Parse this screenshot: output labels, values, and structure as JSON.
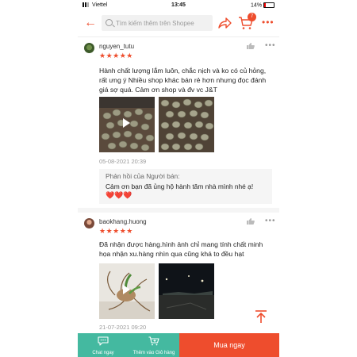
{
  "status_bar": {
    "carrier": "Viettel",
    "time": "13:45",
    "battery": "14%"
  },
  "header": {
    "search_placeholder": "Tìm kiếm thêm trên Shopee",
    "cart_count": "7"
  },
  "reviews": [
    {
      "username": "nguyen_tutu",
      "rating": 5,
      "stars": "★★★★★",
      "text": "Hành chất lượng lắm luôn, chắc nịch và ko có củ hỏng, rất ưng ý Nhiều shop khác bán rẻ hơn nhưng đọc đánh giá sợ quá. Cảm ơn shop và đv vc J&T",
      "date": "05-08-2021 20:39",
      "seller_reply": {
        "title": "Phản hồi của Người bán:",
        "body": "Cảm ơn bạn đã ủng hộ hành tăm nhà mình nhé ạ!",
        "hearts": "❤️❤️❤️"
      }
    },
    {
      "username": "baokhang.huong",
      "rating": 5,
      "stars": "★★★★★",
      "text": "Đã nhận được hàng.hình ảnh chỉ mang tính chất minh họa nhận xu.hàng nhìn qua cũng khá to đều hạt",
      "date": "21-07-2021 09:20"
    }
  ],
  "bottom_bar": {
    "chat_label": "Chat ngay",
    "add_cart_label": "Thêm vào Giỏ hàng",
    "buy_label": "Mua ngay"
  },
  "colors": {
    "brand": "#ee4d2d",
    "bottom_green": "#44b9a0",
    "star": "#ee4d2d"
  }
}
